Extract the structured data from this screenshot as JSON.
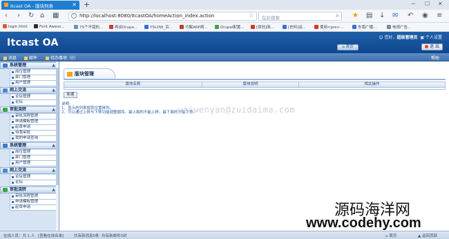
{
  "browser": {
    "tab_title": "Itcast OA - 版块列表",
    "url": "http://localhost:8080/ItcastOA/homeAction_index.action",
    "search_placeholder": "在此搜索",
    "bookmarks": [
      {
        "label": "login.html",
        "color": "#e5533d"
      },
      {
        "label": "Font Aweso...",
        "color": "#2b2b2b"
      },
      {
        "label": "75个不错的...",
        "color": "#6a8fc7"
      },
      {
        "label": "再谈Drupa...",
        "color": "#d0392b"
      },
      {
        "label": "YSLOW_百...",
        "color": "#3a6fd0"
      },
      {
        "label": "巧解ARP病...",
        "color": "#c0392b"
      },
      {
        "label": "Drupal配置...",
        "color": "#3ea34b"
      },
      {
        "label": "[原创]简...",
        "color": "#d0392b"
      },
      {
        "label": "[史料]运...",
        "color": "#3a6fd0"
      },
      {
        "label": "使用<pre>...",
        "color": "#d0392b"
      },
      {
        "label": "东南广播...",
        "color": "#3a6fd0"
      },
      {
        "label": "电视广告...",
        "color": "#7a8a9a"
      }
    ]
  },
  "app": {
    "logo": "Itcast OA",
    "user_prefix": "您好，",
    "user_name": "超级管理员",
    "personal_settings": "个人设置",
    "home_button": "首页",
    "exit_button": "退 出",
    "quickbar": [
      "消息",
      "邮件",
      "待办事项（0）"
    ],
    "manage_link": "帮助"
  },
  "sidebar": {
    "groups": [
      {
        "label": "系统管理",
        "icon_color": "#3f79c8",
        "items": [
          "岗位管理",
          "部门管理",
          "用户管理"
        ]
      },
      {
        "label": "网上交流",
        "icon_color": "#4a88d4",
        "items": [
          "论坛管理",
          "论坛"
        ]
      },
      {
        "label": "审批流转",
        "icon_color": "#3ea34b",
        "items": [
          "审批流程管理",
          "申请模板管理",
          "起草申请",
          "待我审批",
          "我的申请查询"
        ]
      },
      {
        "label": "系统管理",
        "icon_color": "#3f79c8",
        "items": [
          "岗位管理",
          "部门管理",
          "用户管理"
        ]
      },
      {
        "label": "网上交流",
        "icon_color": "#4a88d4",
        "items": [
          "论坛管理",
          "论坛"
        ]
      },
      {
        "label": "审批流转",
        "icon_color": "#3ea34b",
        "items": [
          "审批流程管理",
          "申请模板管理",
          "起草申请"
        ]
      }
    ]
  },
  "content": {
    "page_title": "版块管理",
    "columns": [
      "版块名称",
      "版块说明",
      "相关操作"
    ],
    "new_button": "新建",
    "notes": [
      "说明:",
      "1、显示的列表按其位置排列。",
      "2、可以通过上移与下移功能调整顺序。最上面的不能上移，最下面的不能下移。"
    ]
  },
  "watermarks": {
    "overlay": "weiwenyan@zuidaima.com",
    "brand_cn": "源码海洋网",
    "brand_url": "www.codehy.com"
  },
  "statusbar": {
    "online": "在线人员：共 1 人",
    "view_online": "[查看在线名单]",
    "msg": "共有新消息0条",
    "mail": "共有新邮件0封",
    "home": "首页",
    "back_top": "返回顶部"
  }
}
